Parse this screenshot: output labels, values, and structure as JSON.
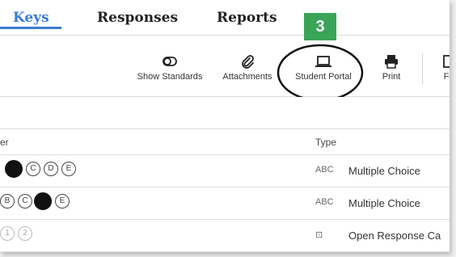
{
  "tabs": [
    {
      "label": "Keys",
      "active": true
    },
    {
      "label": "Responses",
      "active": false
    },
    {
      "label": "Reports",
      "active": false
    }
  ],
  "toolbar": {
    "items": [
      {
        "label": "Show Standards",
        "icon": "toggle-icon"
      },
      {
        "label": "Attachments",
        "icon": "paperclip-icon"
      },
      {
        "label": "Student Portal",
        "icon": "laptop-icon"
      },
      {
        "label": "Print",
        "icon": "printer-icon"
      },
      {
        "label": "Fo",
        "icon": "folder-icon"
      }
    ]
  },
  "callout": {
    "step": "3"
  },
  "table": {
    "columns": {
      "answer": "er",
      "type": "Type"
    },
    "rows": [
      {
        "bubbles": [
          "",
          "C",
          "D",
          "E"
        ],
        "type_icon": "ABC",
        "type": "Multiple Choice"
      },
      {
        "bubbles": [
          "B",
          "C",
          "",
          "E"
        ],
        "type_icon": "ABC",
        "type": "Multiple Choice"
      },
      {
        "bubbles": [
          "1",
          "2"
        ],
        "type_icon": "⊡",
        "type": "Open Response Ca"
      }
    ]
  },
  "colors": {
    "accent": "#3a7bd5",
    "badge": "#3aa558"
  }
}
